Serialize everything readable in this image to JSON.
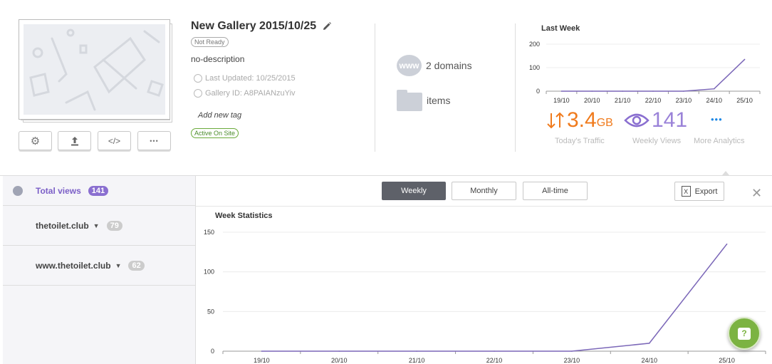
{
  "gallery": {
    "title": "New Gallery 2015/10/25",
    "status_badge": "Not Ready",
    "description": "no-description",
    "last_updated": "Last Updated: 10/25/2015",
    "gallery_id": "Gallery ID: A8PAIANzuYiv",
    "add_tag": "Add new tag",
    "active_badge": "Active On Site"
  },
  "toolbar": [
    {
      "name": "settings-button",
      "icon": "gear-icon",
      "glyph": "⚙"
    },
    {
      "name": "upload-button",
      "icon": "upload-icon",
      "glyph": "⭱"
    },
    {
      "name": "embed-code-button",
      "icon": "code-icon",
      "glyph": "</>"
    },
    {
      "name": "more-button",
      "icon": "ellipsis-icon",
      "glyph": "•••"
    }
  ],
  "domains": {
    "www_glyph": "www",
    "domains_label": "2 domains",
    "items_label": "items"
  },
  "mini_chart": {
    "title": "Last Week"
  },
  "stats": {
    "traffic_value": "3.4",
    "traffic_unit": "GB",
    "traffic_label": "Today's Traffic",
    "views_value": "141",
    "views_label": "Weekly Views",
    "more_glyph": "•••",
    "more_label": "More Analytics"
  },
  "sidebar": {
    "total_label": "Total views",
    "total_count": "141",
    "domains": [
      {
        "label": "thetoilet.club",
        "count": "79"
      },
      {
        "label": "www.thetoilet.club",
        "count": "62"
      }
    ]
  },
  "period": {
    "weekly": "Weekly",
    "monthly": "Monthly",
    "alltime": "All-time",
    "export": "Export",
    "export_icon_glyph": "X",
    "close_glyph": "✕"
  },
  "main_chart": {
    "title": "Week Statistics"
  },
  "help": {
    "glyph": "?"
  },
  "colors": {
    "accent_purple": "#7b5fc7",
    "line_purple": "#7b67b8",
    "traffic_orange": "#f07b1d",
    "help_green": "#7cb342",
    "link_blue": "#1e88e5"
  },
  "chart_data": [
    {
      "type": "line",
      "title": "Last Week",
      "categories": [
        "19/10",
        "20/10",
        "21/10",
        "22/10",
        "23/10",
        "24/10",
        "25/10"
      ],
      "series": [
        {
          "values": [
            0,
            0,
            0,
            0,
            0,
            10,
            135
          ]
        }
      ],
      "yticks": [
        0,
        100,
        200
      ],
      "ylim": [
        0,
        200
      ],
      "grid": true
    },
    {
      "type": "line",
      "title": "Week Statistics",
      "categories": [
        "19/10",
        "20/10",
        "21/10",
        "22/10",
        "23/10",
        "24/10",
        "25/10"
      ],
      "series": [
        {
          "values": [
            0,
            0,
            0,
            0,
            0,
            10,
            135
          ]
        }
      ],
      "yticks": [
        0,
        50,
        100,
        150
      ],
      "ylim": [
        0,
        150
      ],
      "grid": true
    }
  ]
}
